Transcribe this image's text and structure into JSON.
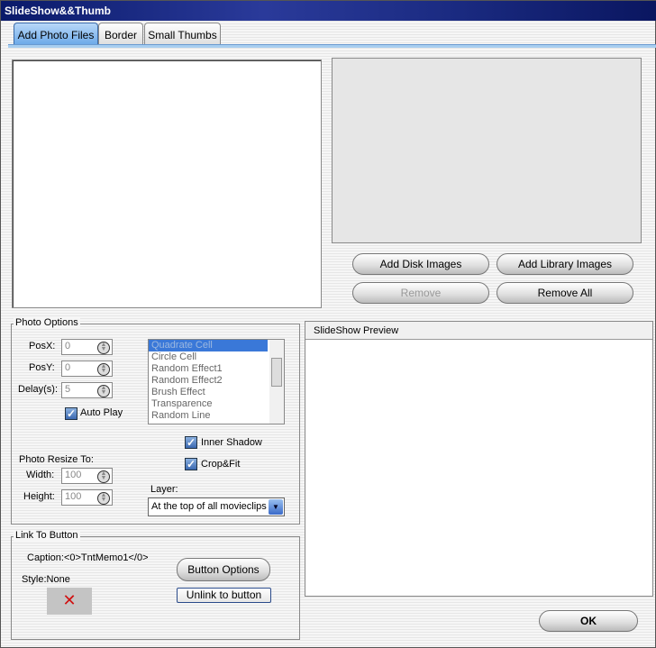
{
  "window": {
    "title": "SlideShow&&Thumb"
  },
  "tabs": [
    {
      "label": "Add Photo Files"
    },
    {
      "label": "Border"
    },
    {
      "label": "Small Thumbs"
    }
  ],
  "buttons": {
    "add_disk": "Add Disk Images",
    "add_library": "Add Library Images",
    "remove": "Remove",
    "remove_all": "Remove All",
    "ok": "OK"
  },
  "photo_options": {
    "title": "Photo Options",
    "posx_label": "PosX:",
    "posx": "0",
    "posy_label": "PosY:",
    "posy": "0",
    "delay_label": "Delay(s):",
    "delay": "5",
    "auto_play": "Auto Play",
    "effects": [
      "Quadrate Cell",
      "Circle Cell",
      "Random Effect1",
      "Random Effect2",
      "Brush Effect",
      "Transparence",
      "Random Line"
    ],
    "inner_shadow": "Inner Shadow",
    "crop_fit": "Crop&Fit",
    "resize_label": "Photo Resize To:",
    "width_label": "Width:",
    "width": "100",
    "height_label": "Height:",
    "height": "100",
    "layer_label": "Layer:",
    "layer": "At the top of all movieclips"
  },
  "link": {
    "title": "Link To Button",
    "caption": "Caption:<0>TntMemo1</0>",
    "style": "Style:None",
    "button_options": "Button Options",
    "unlink": "Unlink to button"
  },
  "preview": {
    "title": "SlideShow Preview"
  }
}
